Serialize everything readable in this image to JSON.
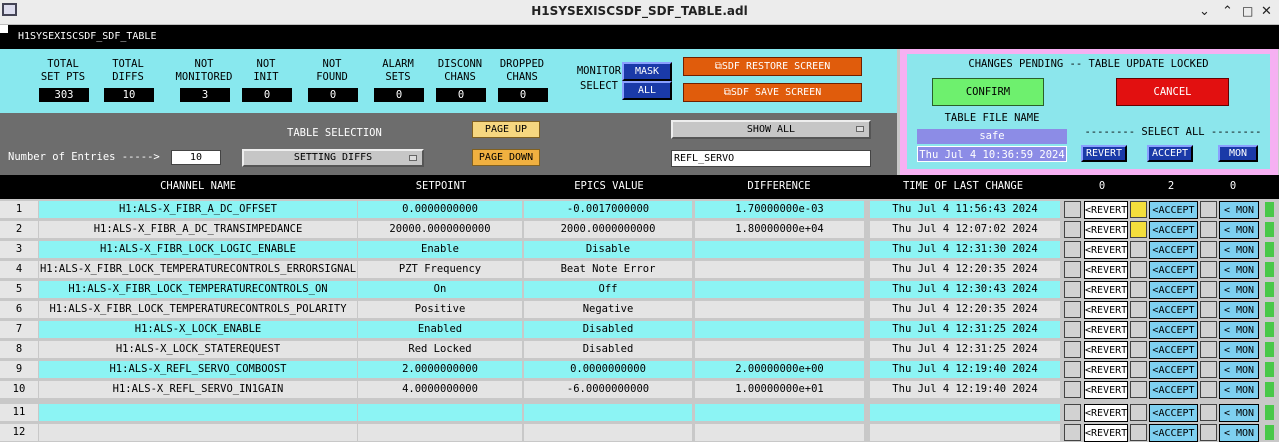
{
  "window": {
    "title": "H1SYSEXISCSDF_SDF_TABLE.adl"
  },
  "screen": {
    "name": "H1SYSEXISCSDF_SDF_TABLE"
  },
  "stats": [
    {
      "label1": "TOTAL",
      "label2": "SET PTS",
      "value": "303"
    },
    {
      "label1": "TOTAL",
      "label2": "DIFFS",
      "value": "10"
    },
    {
      "label1": "NOT",
      "label2": "MONITORED",
      "value": "3"
    },
    {
      "label1": "NOT",
      "label2": "INIT",
      "value": "0"
    },
    {
      "label1": "NOT",
      "label2": "FOUND",
      "value": "0"
    },
    {
      "label1": "ALARM",
      "label2": "SETS",
      "value": "0"
    },
    {
      "label1": "DISCONN",
      "label2": "CHANS",
      "value": "0"
    },
    {
      "label1": "DROPPED",
      "label2": "CHANS",
      "value": "0"
    }
  ],
  "monitor": {
    "label1": "MONITOR",
    "label2": "SELECT",
    "mask": "MASK",
    "all": "ALL"
  },
  "restore_label": "SDF RESTORE SCREEN",
  "save_label": "SDF SAVE SCREEN",
  "entries": {
    "label": "Number of Entries ----->",
    "value": "10"
  },
  "table_selection": {
    "label": "TABLE SELECTION",
    "value": "SETTING DIFFS"
  },
  "page_up": "PAGE UP",
  "page_down": "PAGE DOWN",
  "show": {
    "value": "SHOW ALL"
  },
  "filter": {
    "value": "REFL_SERVO"
  },
  "pending": {
    "title": "CHANGES PENDING -- TABLE UPDATE LOCKED",
    "confirm": "CONFIRM",
    "cancel": "CANCEL",
    "file_label": "TABLE FILE NAME",
    "file_name": "safe",
    "file_time": "Thu Jul  4 10:36:59 2024",
    "select_all": "-------- SELECT ALL --------",
    "revert": "REVERT",
    "accept": "ACCEPT",
    "mon": "MON"
  },
  "columns": {
    "channel": "CHANNEL NAME",
    "setpoint": "SETPOINT",
    "epics": "EPICS VALUE",
    "diff": "DIFFERENCE",
    "time": "TIME OF LAST CHANGE",
    "cnt_revert": "0",
    "cnt_accept": "2",
    "cnt_mon": "0"
  },
  "row_buttons": {
    "revert": "<REVERT",
    "accept": "<ACCEPT",
    "mon": "< MON"
  },
  "rows": [
    {
      "n": "1",
      "ch": "H1:ALS-X_FIBR_A_DC_OFFSET",
      "sp": "0.0000000000",
      "ep": "-0.0017000000",
      "df": "1.70000000e-03",
      "tm": "Thu Jul  4 11:56:43 2024",
      "acc": true
    },
    {
      "n": "2",
      "ch": "H1:ALS-X_FIBR_A_DC_TRANSIMPEDANCE",
      "sp": "20000.0000000000",
      "ep": "2000.0000000000",
      "df": "1.80000000e+04",
      "tm": "Thu Jul  4 12:07:02 2024",
      "acc": true
    },
    {
      "n": "3",
      "ch": "H1:ALS-X_FIBR_LOCK_LOGIC_ENABLE",
      "sp": "Enable",
      "ep": "Disable",
      "df": "",
      "tm": "Thu Jul  4 12:31:30 2024",
      "acc": false
    },
    {
      "n": "4",
      "ch": "H1:ALS-X_FIBR_LOCK_TEMPERATURECONTROLS_ERRORSIGNAL",
      "sp": "PZT Frequency",
      "ep": "Beat Note Error",
      "df": "",
      "tm": "Thu Jul  4 12:20:35 2024",
      "acc": false
    },
    {
      "n": "5",
      "ch": "H1:ALS-X_FIBR_LOCK_TEMPERATURECONTROLS_ON",
      "sp": "On",
      "ep": "Off",
      "df": "",
      "tm": "Thu Jul  4 12:30:43 2024",
      "acc": false
    },
    {
      "n": "6",
      "ch": "H1:ALS-X_FIBR_LOCK_TEMPERATURECONTROLS_POLARITY",
      "sp": "Positive",
      "ep": "Negative",
      "df": "",
      "tm": "Thu Jul  4 12:20:35 2024",
      "acc": false
    },
    {
      "n": "7",
      "ch": "H1:ALS-X_LOCK_ENABLE",
      "sp": "Enabled",
      "ep": "Disabled",
      "df": "",
      "tm": "Thu Jul  4 12:31:25 2024",
      "acc": false
    },
    {
      "n": "8",
      "ch": "H1:ALS-X_LOCK_STATEREQUEST",
      "sp": "Red Locked",
      "ep": "Disabled",
      "df": "",
      "tm": "Thu Jul  4 12:31:25 2024",
      "acc": false
    },
    {
      "n": "9",
      "ch": "H1:ALS-X_REFL_SERVO_COMBOOST",
      "sp": "2.0000000000",
      "ep": "0.0000000000",
      "df": "2.00000000e+00",
      "tm": "Thu Jul  4 12:19:40 2024",
      "acc": false
    },
    {
      "n": "10",
      "ch": "H1:ALS-X_REFL_SERVO_IN1GAIN",
      "sp": "4.0000000000",
      "ep": "-6.0000000000",
      "df": "1.00000000e+01",
      "tm": "Thu Jul  4 12:19:40 2024",
      "acc": false
    },
    {
      "n": "11",
      "ch": "",
      "sp": "",
      "ep": "",
      "df": "",
      "tm": "",
      "acc": false
    },
    {
      "n": "12",
      "ch": "",
      "sp": "",
      "ep": "",
      "df": "",
      "tm": "",
      "acc": false
    }
  ]
}
